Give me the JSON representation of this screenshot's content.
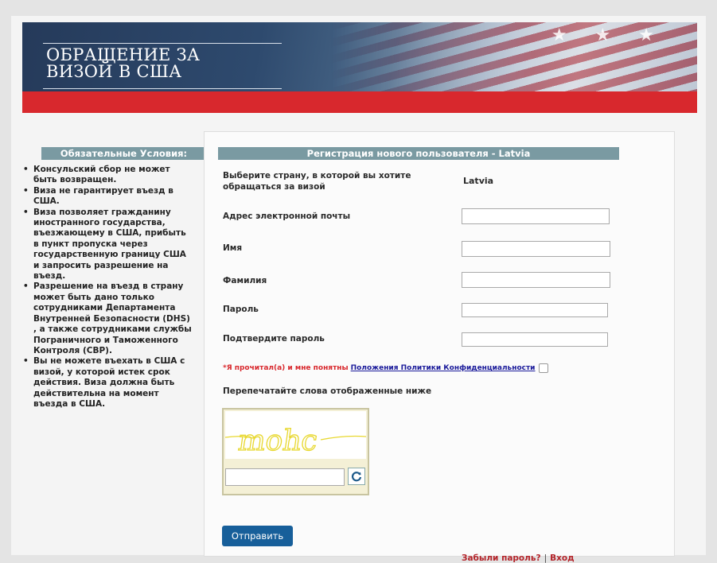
{
  "banner": {
    "title_line1": "ОБРАЩЕНИЕ ЗА",
    "title_line2": "ВИЗОЙ В США"
  },
  "sidebar": {
    "heading": "Обязательные Условия:",
    "items": [
      "Консульский сбор не может быть возвращен.",
      "Виза не гарантирует въезд в США.",
      "Виза позволяет гражданину иностранного государства, въезжающему в США, прибыть в пункт пропуска через государственную границу США и запросить разрешение на въезд.",
      "Разрешение на въезд в страну может быть дано только сотрудниками Департамента Внутренней Безопасности (DHS) , а также сотрудниками службы Пограничного и Таможенного Контроля (CBP).",
      "Вы не можете въехать в США с визой, у которой истек срок действия. Виза должна быть действительна на момент въезда в США."
    ]
  },
  "form": {
    "heading": "Регистрация нового пользователя - Latvia",
    "country_label": "Выберите страну, в которой вы хотите обращаться за визой",
    "country_value": "Latvia",
    "email_label": "Адрес электронной почты",
    "email_value": "",
    "first_name_label": "Имя",
    "first_name_value": "",
    "last_name_label": "Фамилия",
    "last_name_value": "",
    "password_label": "Пароль",
    "password_value": "",
    "confirm_password_label": "Подтвердите пароль",
    "confirm_password_value": "",
    "privacy_prefix": "*Я прочитал(а) и мне понятны",
    "privacy_link": "Положения Политики Конфиденциальности",
    "privacy_checked": false,
    "captcha_label": "Перепечатайте слова отображенные ниже",
    "captcha_word": "mohc",
    "captcha_value": "",
    "submit_label": "Отправить",
    "forgot_label": "Забыли пароль?",
    "separator": "|",
    "login_label": "Вход"
  },
  "colors": {
    "accent_red": "#d8282d",
    "header_gray_blue": "#7a9aa2",
    "button_blue": "#175f9a",
    "captcha_text_yellow": "#e8d830"
  },
  "icons": {
    "captcha_refresh": "refresh-icon"
  }
}
